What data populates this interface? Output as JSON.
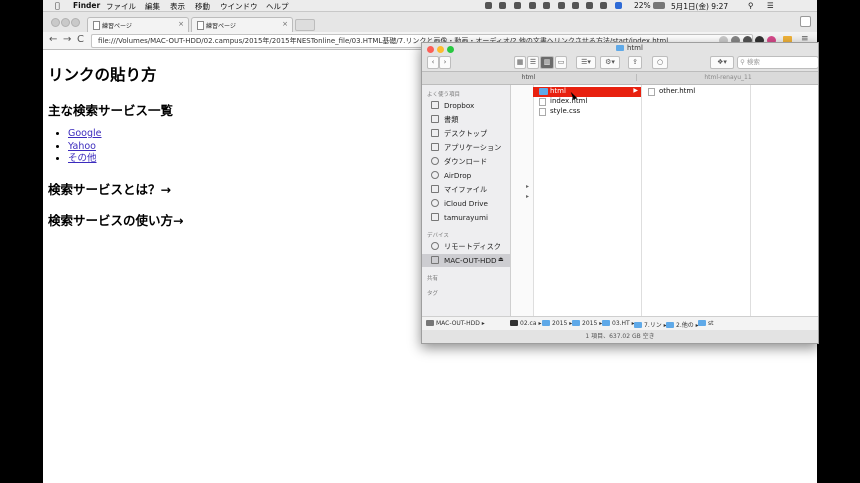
{
  "menubar": {
    "apple": "",
    "items": [
      "Finder",
      "ファイル",
      "編集",
      "表示",
      "移動",
      "ウインドウ",
      "ヘルプ"
    ],
    "battery": "22%",
    "datetime": "5月1日(金) 9:27"
  },
  "browser": {
    "tabs": [
      {
        "label": "練習ページ"
      },
      {
        "label": "練習ページ"
      }
    ],
    "nav": {
      "back": "←",
      "forward": "→",
      "reload": "C"
    },
    "url": "file:///Volumes/MAC-OUT-HDD/02.campus/2015年/2015年NESTonline_file/03.HTML基礎/7.リンクと画像・動画・オーディオ/2.他の文書へリンクさせる方法/start/index.html"
  },
  "page": {
    "title": "リンクの貼り方",
    "section1": "主な検索サービス一覧",
    "links": [
      "Google",
      "Yahoo",
      "その他"
    ],
    "section2": "検索サービスとは？→",
    "section3": "検索サービスの使い方→"
  },
  "finder": {
    "window_title": "html",
    "search_placeholder": "検索",
    "path_tabs": [
      "html",
      "html-renayu_11"
    ],
    "sidebar": {
      "favorites_header": "よく使う項目",
      "favorites": [
        "Dropbox",
        "書類",
        "デスクトップ",
        "アプリケーション",
        "ダウンロード",
        "AirDrop",
        "マイファイル",
        "iCloud Drive",
        "tamurayumi"
      ],
      "devices_header": "デバイス",
      "devices": [
        "リモートディスク",
        "MAC-OUT-HDD"
      ],
      "shared_header": "共有",
      "tags_header": "タグ"
    },
    "column1": [
      "html",
      "index.html",
      "style.css"
    ],
    "column2": [
      "other.html"
    ],
    "breadcrumb": [
      "MAC-OUT-HDD",
      "02.ca",
      "2015",
      "2015",
      "03.HT",
      "7.リン",
      "2.他の",
      "st"
    ],
    "status": "1 項目、637.02 GB 空き"
  }
}
